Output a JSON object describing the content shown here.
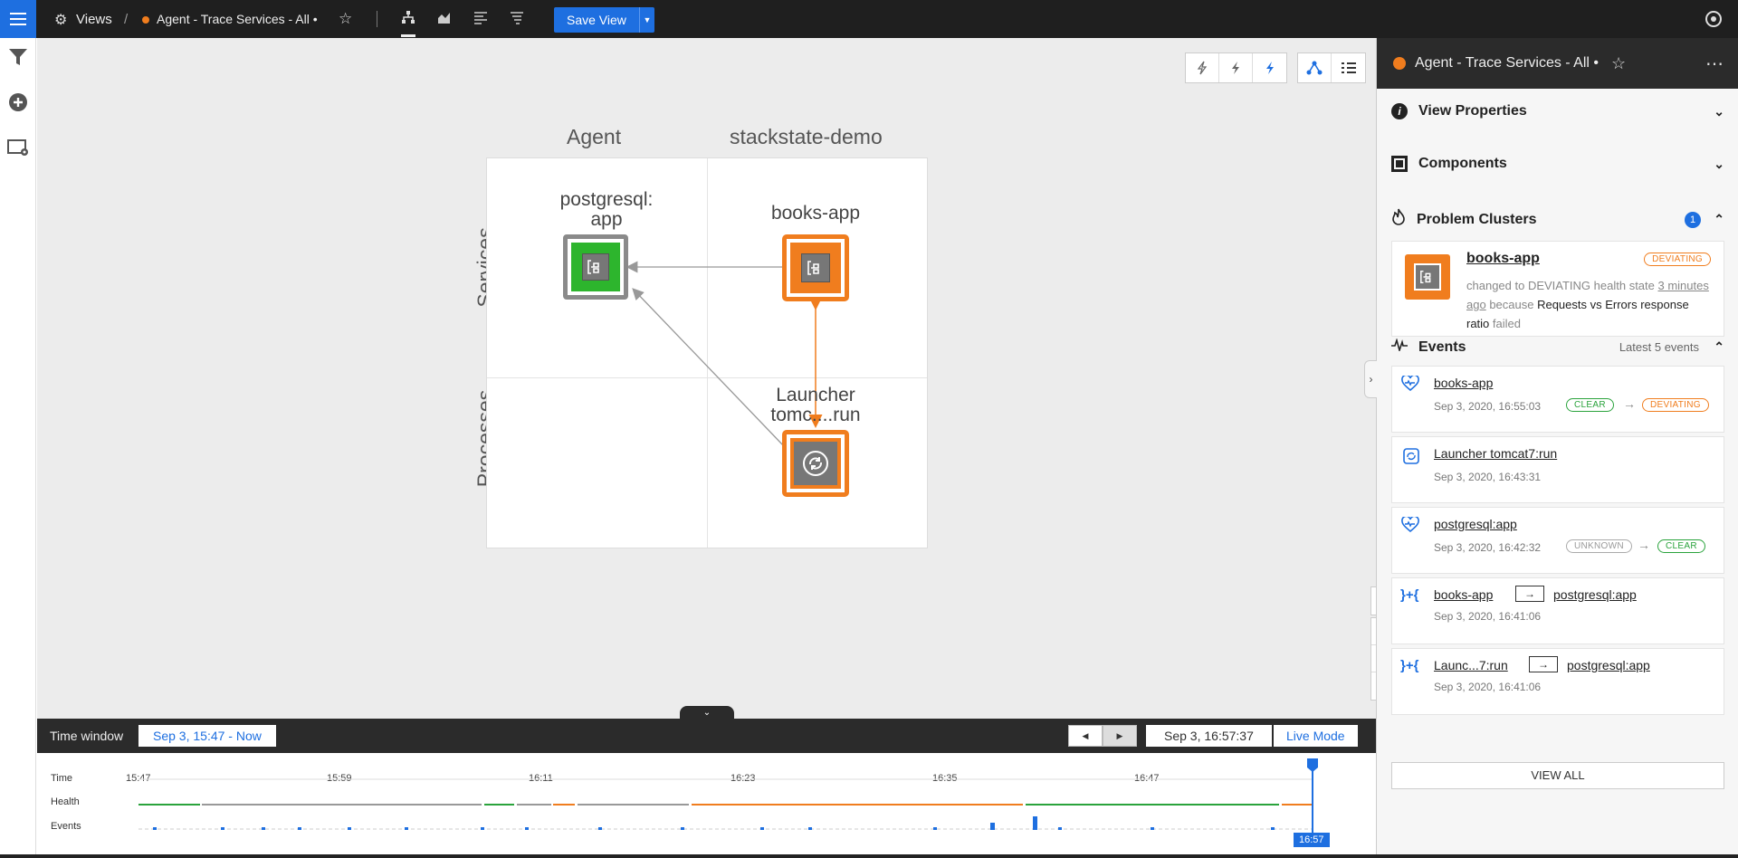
{
  "topbar": {
    "views_label": "Views",
    "separator": "/",
    "view_title": "Agent - Trace Services - All •",
    "save_label": "Save View"
  },
  "canvas": {
    "col_headers": [
      "Agent",
      "stackstate-demo"
    ],
    "row_headers": [
      "Services",
      "Processes"
    ],
    "nodes": [
      {
        "label_line1": "postgresql:",
        "label_line2": "app",
        "state": "CLEAR"
      },
      {
        "label_line1": "books-app",
        "label_line2": "",
        "state": "DEVIATING"
      },
      {
        "label_line1": "Launcher",
        "label_line2": "tomc....run",
        "state": "DEVIATING"
      }
    ],
    "zoom": {
      "search": "⌕",
      "plus": "+",
      "fit": "⊹",
      "minus": "-"
    }
  },
  "time_window": {
    "label": "Time window",
    "range": "Sep 3, 15:47 - Now",
    "current_time": "Sep 3, 16:57:37",
    "live_label": "Live Mode"
  },
  "timeline": {
    "row_labels": [
      "Time",
      "Health",
      "Events"
    ],
    "ticks": [
      "15:47",
      "15:59",
      "16:11",
      "16:23",
      "16:35",
      "16:47"
    ],
    "cursor_time": "16:57"
  },
  "panel": {
    "title": "Agent - Trace Services - All •",
    "sections": {
      "view_properties": "View Properties",
      "components": "Components",
      "problem_clusters": "Problem Clusters",
      "problem_count": "1",
      "events": "Events",
      "events_sub": "Latest 5 events"
    },
    "problem": {
      "name": "books-app",
      "badge": "DEVIATING",
      "text_a": "changed to DEVIATING health state ",
      "text_link": "3 minutes ago",
      "text_b": " because ",
      "text_reason": "Requests vs Errors response ratio",
      "text_c": " failed"
    },
    "events": [
      {
        "title": "books-app",
        "date": "Sep 3, 2020, 16:55:03",
        "from": "CLEAR",
        "to": "DEVIATING"
      },
      {
        "title": "Launcher tomcat7:run",
        "date": "Sep 3, 2020, 16:43:31"
      },
      {
        "title": "postgresql:app",
        "date": "Sep 3, 2020, 16:42:32",
        "from": "UNKNOWN",
        "to": "CLEAR"
      },
      {
        "title": "books-app",
        "target": "postgresql:app",
        "date": "Sep 3, 2020, 16:41:06"
      },
      {
        "title": "Launc...7:run",
        "target": "postgresql:app",
        "date": "Sep 3, 2020, 16:41:06"
      }
    ],
    "view_all": "VIEW ALL"
  },
  "colors": {
    "accent": "#1e6fe0",
    "deviating": "#f07d1e",
    "clear": "#2aa33c",
    "unknown": "#8a8a8a"
  }
}
